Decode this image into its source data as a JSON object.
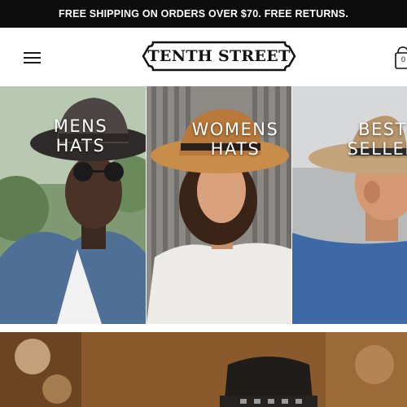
{
  "announcement": "FREE SHIPPING ON ORDERS OVER $70. FREE RETURNS.",
  "header": {
    "logo_text": "TENTH STREET",
    "menu_icon": "hamburger-menu-icon",
    "cart_icon": "shopping-bag-icon",
    "cart_count": "0"
  },
  "category_tiles": [
    {
      "line1": "MENS",
      "line2": "HATS"
    },
    {
      "line1": "WOMENS",
      "line2": "HATS"
    },
    {
      "line1": "BEST",
      "line2": "SELLER"
    }
  ],
  "colors": {
    "announcement_bg": "#0c0c0c",
    "text_light": "#ffffff",
    "text_dark": "#111111"
  }
}
